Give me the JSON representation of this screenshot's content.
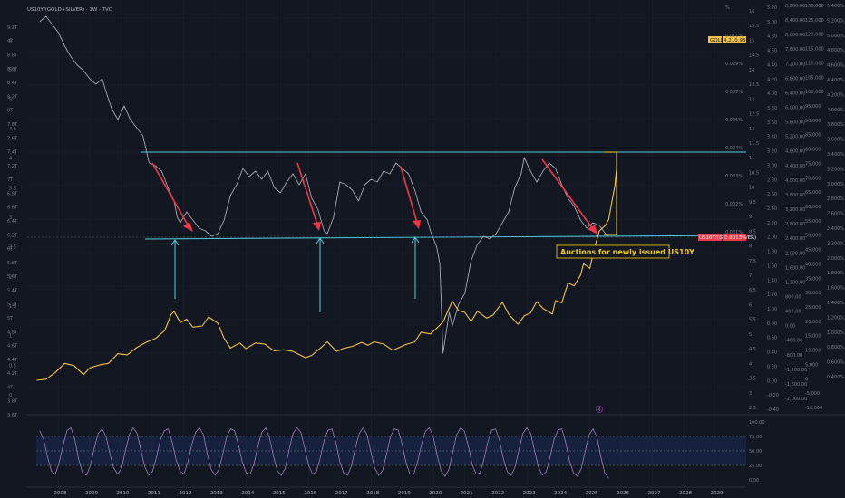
{
  "header": {
    "title": "US10Y/(GOLD+SILVER) · 1W · TVC"
  },
  "axes": {
    "left_labels": [
      "9.2T",
      "9T",
      "8.8T",
      "8.6T",
      "8.4T",
      "8.2T",
      "8T",
      "7.8T",
      "7.6T",
      "7.4T",
      "7.2T",
      "7T",
      "6.8T",
      "6.6T",
      "6.4T",
      "6.2T",
      "6T",
      "5.8T",
      "5.6T",
      "5.4T",
      "5.2T",
      "5T",
      "4.8T",
      "4.6T",
      "4.4T",
      "4.2T",
      "4T",
      "3.8T",
      "3.6T"
    ],
    "left_small": [
      "6",
      "5.5",
      "5",
      "4.5",
      "4",
      "3.5",
      "3",
      "2.5",
      "2",
      "1.5",
      "1",
      "0.5",
      "0"
    ],
    "pct_labels": [
      "%",
      "0.011%",
      "0.009%",
      "0.007%",
      "0.005%",
      "0.004%",
      "0.003%",
      "0.002%",
      "0.001%"
    ],
    "col_a": [
      "16",
      "15.5",
      "15",
      "14.5",
      "14",
      "13.5",
      "13",
      "12.5",
      "12",
      "11.5",
      "11",
      "10.5",
      "10",
      "9.5",
      "9",
      "8.5",
      "8",
      "7.5",
      "7",
      "6.5",
      "6",
      "5.5",
      "5",
      "4.5",
      "4",
      "3.5",
      "3",
      "2.5"
    ],
    "col_b": [
      "5.20",
      "5.00",
      "4.80",
      "4.60",
      "4.40",
      "4.20",
      "4.00",
      "3.80",
      "3.60",
      "3.40",
      "3.20",
      "3.00",
      "2.80",
      "2.60",
      "2.40",
      "2.20",
      "2.00",
      "1.80",
      "1.60",
      "1.40",
      "1.20",
      "1.00",
      "0.80",
      "0.60",
      "0.40",
      "0.20",
      "0.00",
      "-0.20",
      "-0.40"
    ],
    "col_c": [
      "8,800.00",
      "8,400.00",
      "8,000.00",
      "7,600.00",
      "7,200.00",
      "6,800.00",
      "6,400.00",
      "6,000.00",
      "5,600.00",
      "5,200.00",
      "4,800.00",
      "4,400.00",
      "4,000.00",
      "3,600.00",
      "3,200.00",
      "2,800.00",
      "2,400.00",
      "2,000.00",
      "1,600.00",
      "1,200.00",
      "800.00",
      "400.00",
      "0.00",
      "-400.00",
      "-800.00",
      "-1,200.00",
      "-1,600.00",
      "-2,000.00"
    ],
    "col_d": [
      "130,000",
      "125,000",
      "120,000",
      "115,000",
      "110,000",
      "105,000",
      "100,000",
      "95,000",
      "90,000",
      "85,000",
      "80,000",
      "75,000",
      "70,000",
      "65,000",
      "60,000",
      "55,000",
      "50,000",
      "45,000",
      "40,000",
      "35,000",
      "30,000",
      "25,000",
      "20,000",
      "15,000",
      "10,000",
      "5,000",
      "0",
      "-5,000",
      "-10,000"
    ],
    "col_e": [
      "5.400%",
      "5.200%",
      "5.000%",
      "4.800%",
      "4.600%",
      "4.400%",
      "4.200%",
      "4.000%",
      "3.800%",
      "3.600%",
      "3.400%",
      "3.200%",
      "3.000%",
      "2.800%",
      "2.600%",
      "2.400%",
      "2.200%",
      "2.000%",
      "1.800%",
      "1.600%",
      "1.400%",
      "1.200%",
      "1.000%",
      "0.800%",
      "0.600%",
      "0.400%"
    ],
    "osc_labels": [
      "100.00",
      "75.00",
      "50.00",
      "25.00",
      "0.00"
    ]
  },
  "tags": {
    "gold_label": "GOLD",
    "gold_value": "4,210.930",
    "ratio_label": "US10Y/(GOLD+SILVER)",
    "ratio_value": "0.0013%"
  },
  "annotation": {
    "text": "Auctions for newly issued US10Y"
  },
  "event_marker": "4",
  "chart_data": {
    "type": "line",
    "x_range": [
      2007,
      2030
    ],
    "x_ticks": [
      "2008",
      "2009",
      "2010",
      "2011",
      "2012",
      "2013",
      "2014",
      "2015",
      "2016",
      "2017",
      "2018",
      "2019",
      "2020",
      "2021",
      "2022",
      "2023",
      "2024",
      "2025",
      "2026",
      "2027",
      "2028",
      "2029"
    ],
    "series": [
      {
        "name": "US10Y/(GOLD+SILVER)",
        "color": "#a6a6ad",
        "unit": "%",
        "points": [
          [
            2007.4,
            0.0092
          ],
          [
            2007.6,
            0.0094
          ],
          [
            2007.8,
            0.0091
          ],
          [
            2008.0,
            0.0088
          ],
          [
            2008.2,
            0.0083
          ],
          [
            2008.4,
            0.0079
          ],
          [
            2008.6,
            0.0076
          ],
          [
            2008.8,
            0.0074
          ],
          [
            2009.0,
            0.0071
          ],
          [
            2009.2,
            0.0069
          ],
          [
            2009.4,
            0.0071
          ],
          [
            2009.5,
            0.0067
          ],
          [
            2009.7,
            0.006
          ],
          [
            2009.9,
            0.0056
          ],
          [
            2010.1,
            0.0061
          ],
          [
            2010.3,
            0.0056
          ],
          [
            2010.5,
            0.0053
          ],
          [
            2010.7,
            0.005
          ],
          [
            2010.9,
            0.004
          ],
          [
            2011.1,
            0.0039
          ],
          [
            2011.3,
            0.0037
          ],
          [
            2011.5,
            0.0031
          ],
          [
            2011.7,
            0.0026
          ],
          [
            2011.8,
            0.002
          ],
          [
            2011.9,
            0.0018
          ],
          [
            2012.1,
            0.0022
          ],
          [
            2012.3,
            0.0019
          ],
          [
            2012.5,
            0.0016
          ],
          [
            2012.7,
            0.0015
          ],
          [
            2012.9,
            0.0013
          ],
          [
            2013.1,
            0.0014
          ],
          [
            2013.3,
            0.0019
          ],
          [
            2013.5,
            0.0028
          ],
          [
            2013.7,
            0.0032
          ],
          [
            2013.9,
            0.0038
          ],
          [
            2014.1,
            0.0035
          ],
          [
            2014.3,
            0.0037
          ],
          [
            2014.5,
            0.0034
          ],
          [
            2014.7,
            0.0037
          ],
          [
            2014.9,
            0.0031
          ],
          [
            2015.1,
            0.0029
          ],
          [
            2015.3,
            0.0033
          ],
          [
            2015.5,
            0.0036
          ],
          [
            2015.7,
            0.0032
          ],
          [
            2015.9,
            0.0036
          ],
          [
            2016.1,
            0.0027
          ],
          [
            2016.3,
            0.0023
          ],
          [
            2016.5,
            0.0015
          ],
          [
            2016.6,
            0.0014
          ],
          [
            2016.8,
            0.002
          ],
          [
            2017.0,
            0.0033
          ],
          [
            2017.2,
            0.0032
          ],
          [
            2017.4,
            0.003
          ],
          [
            2017.6,
            0.0026
          ],
          [
            2017.8,
            0.0032
          ],
          [
            2018.0,
            0.0034
          ],
          [
            2018.2,
            0.0033
          ],
          [
            2018.4,
            0.0037
          ],
          [
            2018.6,
            0.0036
          ],
          [
            2018.8,
            0.004
          ],
          [
            2019.0,
            0.0038
          ],
          [
            2019.2,
            0.0036
          ],
          [
            2019.4,
            0.003
          ],
          [
            2019.6,
            0.0022
          ],
          [
            2019.8,
            0.0019
          ],
          [
            2019.9,
            0.0015
          ],
          [
            2020.1,
            0.0009
          ],
          [
            2020.2,
            0.0003
          ],
          [
            2020.3,
            -0.003
          ],
          [
            2020.5,
            -0.0015
          ],
          [
            2020.6,
            -0.002
          ],
          [
            2020.8,
            -0.0012
          ],
          [
            2021.0,
            -0.0008
          ],
          [
            2021.2,
            0.0004
          ],
          [
            2021.4,
            0.001
          ],
          [
            2021.6,
            0.0013
          ],
          [
            2021.8,
            0.0012
          ],
          [
            2022.0,
            0.0014
          ],
          [
            2022.2,
            0.0018
          ],
          [
            2022.4,
            0.0022
          ],
          [
            2022.6,
            0.0031
          ],
          [
            2022.8,
            0.0036
          ],
          [
            2022.9,
            0.0042
          ],
          [
            2023.1,
            0.0037
          ],
          [
            2023.3,
            0.0033
          ],
          [
            2023.5,
            0.0037
          ],
          [
            2023.7,
            0.004
          ],
          [
            2023.9,
            0.0038
          ],
          [
            2024.1,
            0.0032
          ],
          [
            2024.3,
            0.0027
          ],
          [
            2024.5,
            0.0024
          ],
          [
            2024.7,
            0.0019
          ],
          [
            2024.9,
            0.0016
          ],
          [
            2025.1,
            0.0018
          ],
          [
            2025.3,
            0.0017
          ],
          [
            2025.5,
            0.0014
          ],
          [
            2025.6,
            0.0013
          ]
        ]
      },
      {
        "name": "GOLD",
        "color": "#f5c242",
        "unit": "USD",
        "points": [
          [
            2007.3,
            660
          ],
          [
            2007.6,
            680
          ],
          [
            2007.9,
            800
          ],
          [
            2008.2,
            960
          ],
          [
            2008.5,
            920
          ],
          [
            2008.8,
            760
          ],
          [
            2009.0,
            880
          ],
          [
            2009.3,
            930
          ],
          [
            2009.6,
            960
          ],
          [
            2009.9,
            1130
          ],
          [
            2010.2,
            1110
          ],
          [
            2010.5,
            1240
          ],
          [
            2010.8,
            1330
          ],
          [
            2011.1,
            1400
          ],
          [
            2011.4,
            1540
          ],
          [
            2011.6,
            1820
          ],
          [
            2011.7,
            1880
          ],
          [
            2011.9,
            1680
          ],
          [
            2012.1,
            1740
          ],
          [
            2012.3,
            1600
          ],
          [
            2012.6,
            1620
          ],
          [
            2012.8,
            1780
          ],
          [
            2013.1,
            1670
          ],
          [
            2013.3,
            1400
          ],
          [
            2013.5,
            1230
          ],
          [
            2013.8,
            1320
          ],
          [
            2014.0,
            1220
          ],
          [
            2014.3,
            1320
          ],
          [
            2014.6,
            1300
          ],
          [
            2014.9,
            1180
          ],
          [
            2015.2,
            1200
          ],
          [
            2015.5,
            1170
          ],
          [
            2015.9,
            1060
          ],
          [
            2016.1,
            1100
          ],
          [
            2016.4,
            1240
          ],
          [
            2016.6,
            1340
          ],
          [
            2016.9,
            1170
          ],
          [
            2017.1,
            1220
          ],
          [
            2017.4,
            1260
          ],
          [
            2017.7,
            1330
          ],
          [
            2017.9,
            1280
          ],
          [
            2018.1,
            1340
          ],
          [
            2018.4,
            1300
          ],
          [
            2018.7,
            1190
          ],
          [
            2018.9,
            1240
          ],
          [
            2019.1,
            1290
          ],
          [
            2019.4,
            1340
          ],
          [
            2019.6,
            1510
          ],
          [
            2019.9,
            1480
          ],
          [
            2020.1,
            1580
          ],
          [
            2020.3,
            1690
          ],
          [
            2020.6,
            2060
          ],
          [
            2020.8,
            1890
          ],
          [
            2021.0,
            1860
          ],
          [
            2021.2,
            1700
          ],
          [
            2021.4,
            1880
          ],
          [
            2021.7,
            1760
          ],
          [
            2021.9,
            1810
          ],
          [
            2022.2,
            2040
          ],
          [
            2022.4,
            1830
          ],
          [
            2022.7,
            1650
          ],
          [
            2022.9,
            1800
          ],
          [
            2023.1,
            1850
          ],
          [
            2023.3,
            2050
          ],
          [
            2023.5,
            1930
          ],
          [
            2023.8,
            1830
          ],
          [
            2023.9,
            2070
          ],
          [
            2024.1,
            2030
          ],
          [
            2024.3,
            2380
          ],
          [
            2024.5,
            2330
          ],
          [
            2024.7,
            2520
          ],
          [
            2024.8,
            2720
          ],
          [
            2025.0,
            2640
          ],
          [
            2025.1,
            2900
          ],
          [
            2025.3,
            3300
          ],
          [
            2025.5,
            3400
          ],
          [
            2025.6,
            3500
          ],
          [
            2025.7,
            3800
          ],
          [
            2025.8,
            4100
          ],
          [
            2025.85,
            4381
          ]
        ]
      }
    ],
    "oscillator": {
      "range": [
        0,
        100
      ],
      "levels": [
        75,
        50,
        25
      ],
      "color": "#9b7fb6",
      "values": [
        85,
        70,
        40,
        15,
        10,
        30,
        60,
        85,
        90,
        70,
        35,
        12,
        8,
        25,
        55,
        80,
        88,
        75,
        45,
        20,
        10,
        20,
        50,
        78,
        90,
        80,
        50,
        22,
        8,
        15,
        40,
        70,
        85,
        88,
        65,
        35,
        15,
        10,
        30,
        60,
        82,
        90,
        78,
        45,
        18,
        8,
        18,
        45,
        75,
        88,
        85,
        60,
        30,
        12,
        10,
        28,
        58,
        82,
        90,
        72,
        40,
        15,
        8,
        20,
        52,
        80,
        90,
        82,
        55,
        25,
        10,
        14,
        38,
        68,
        86,
        88,
        65,
        32,
        12,
        8,
        24,
        55,
        80,
        90,
        78,
        48,
        20,
        8,
        16,
        44,
        74,
        88,
        86,
        62,
        30,
        10,
        10,
        32,
        62,
        84,
        90,
        74,
        42,
        16,
        6,
        18,
        48,
        78,
        90,
        84,
        58,
        26,
        10,
        12,
        36,
        66,
        86,
        88,
        68,
        36,
        14,
        8,
        22,
        52,
        80,
        90,
        80,
        50,
        22,
        8,
        14,
        40,
        70,
        86,
        88,
        64,
        32,
        12,
        6,
        20,
        50,
        78,
        88,
        74,
        40,
        12,
        3
      ]
    }
  }
}
